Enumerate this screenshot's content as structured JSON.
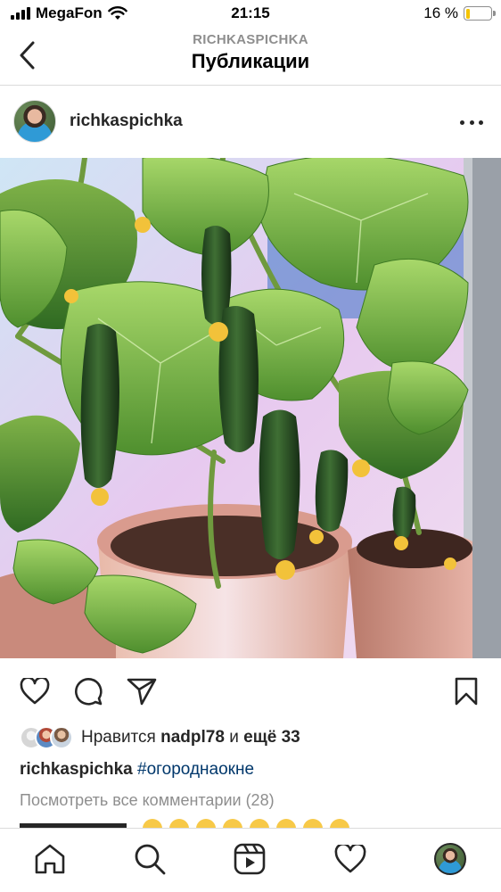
{
  "status_bar": {
    "carrier": "MegaFon",
    "time": "21:15",
    "battery_percent": "16 %",
    "battery_level": 0.16,
    "battery_color": "#f5c400"
  },
  "header": {
    "subtitle": "RICHKASPICHKA",
    "title": "Публикации",
    "back_icon": "chevron-left-icon"
  },
  "post": {
    "username": "richkaspichka",
    "more_icon": "more-horizontal-icon",
    "image_subject": "cucumber-plants-in-pots-photo",
    "likes": {
      "prefix": "Нравится",
      "user": "nadpl78",
      "joiner": "и",
      "others": "ещё 33"
    },
    "caption": {
      "username": "richkaspichka",
      "hashtag": "#огороднаокне"
    },
    "view_comments": "Посмотреть все комментарии (28)"
  },
  "actions": [
    "heart-icon",
    "comment-icon",
    "share-icon",
    "bookmark-icon"
  ],
  "tab_bar": [
    "home-icon",
    "search-icon",
    "reels-icon",
    "activity-icon",
    "profile-avatar"
  ],
  "colors": {
    "text": "#262626",
    "secondary": "#8e8e8e",
    "hashtag": "#00376b",
    "divider": "#dbdbdb"
  }
}
